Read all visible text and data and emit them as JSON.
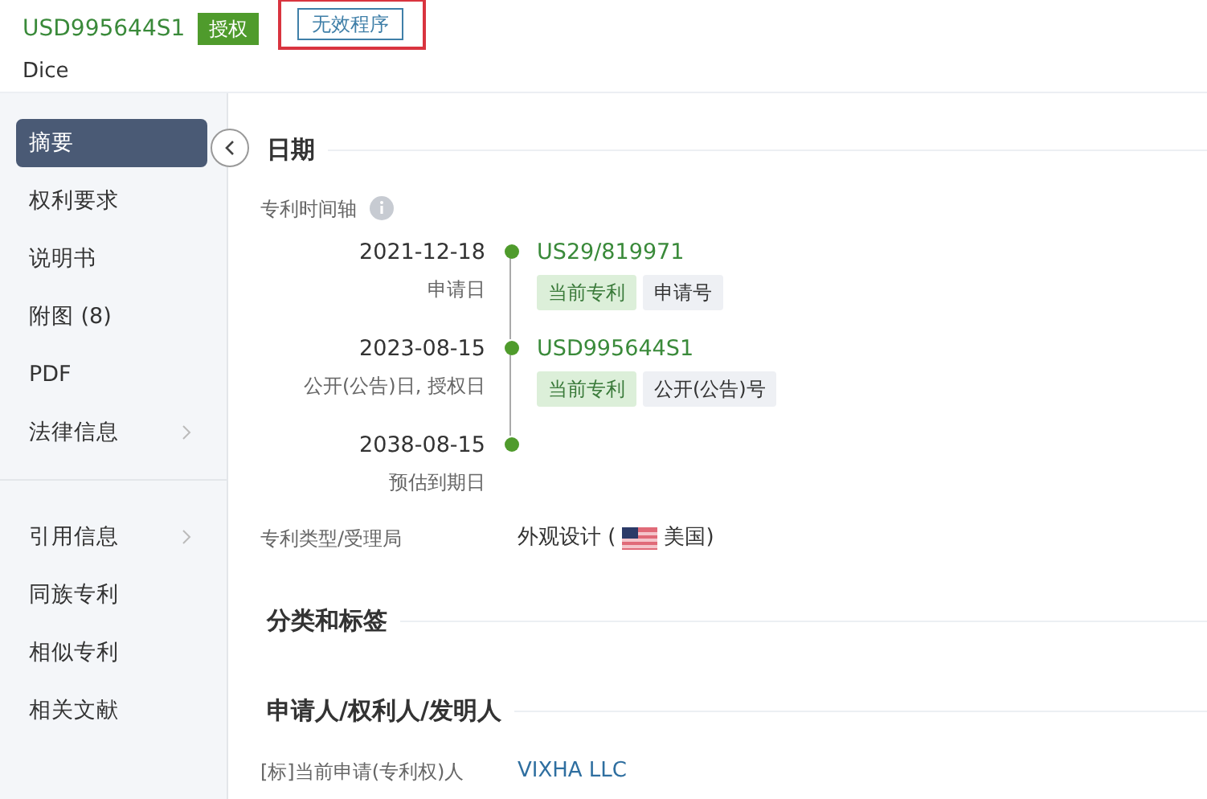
{
  "header": {
    "patent_number": "USD995644S1",
    "tags": [
      {
        "kind": "status",
        "label": "授权",
        "highlighted": false
      },
      {
        "kind": "outline",
        "label": "无效程序",
        "highlighted": true
      }
    ],
    "title": "Dice"
  },
  "sidebar": {
    "groups": [
      [
        {
          "label": "摘要",
          "selected": true,
          "expandable": false
        },
        {
          "label": "权利要求",
          "selected": false,
          "expandable": false
        },
        {
          "label": "说明书",
          "selected": false,
          "expandable": false
        },
        {
          "label": "附图 (8)",
          "selected": false,
          "expandable": false
        },
        {
          "label": "PDF",
          "selected": false,
          "expandable": false
        },
        {
          "label": "法律信息",
          "selected": false,
          "expandable": true
        }
      ],
      [
        {
          "label": "引用信息",
          "selected": false,
          "expandable": true
        },
        {
          "label": "同族专利",
          "selected": false,
          "expandable": false
        },
        {
          "label": "相似专利",
          "selected": false,
          "expandable": false
        },
        {
          "label": "相关文献",
          "selected": false,
          "expandable": false
        }
      ]
    ]
  },
  "dates_section": {
    "title": "日期",
    "timeline_label": "专利时间轴",
    "timeline": [
      {
        "date": "2021-12-18",
        "caption": "申请日",
        "number": "US29/819971",
        "tags": [
          {
            "kind": "current",
            "label": "当前专利"
          },
          {
            "kind": "plain",
            "label": "申请号"
          }
        ]
      },
      {
        "date": "2023-08-15",
        "caption": "公开(公告)日, 授权日",
        "number": "USD995644S1",
        "tags": [
          {
            "kind": "current",
            "label": "当前专利"
          },
          {
            "kind": "plain",
            "label": "公开(公告)号"
          }
        ]
      },
      {
        "date": "2038-08-15",
        "caption": "预估到期日"
      }
    ],
    "type_label": "专利类型/受理局",
    "type_value": "外观设计 (",
    "country": "美国)"
  },
  "classification_section": {
    "title": "分类和标签"
  },
  "parties_section": {
    "title": "申请人/权利人/发明人",
    "rows": [
      {
        "label": "[标]当前申请(专利权)人",
        "value": "VIXHA LLC"
      }
    ]
  }
}
